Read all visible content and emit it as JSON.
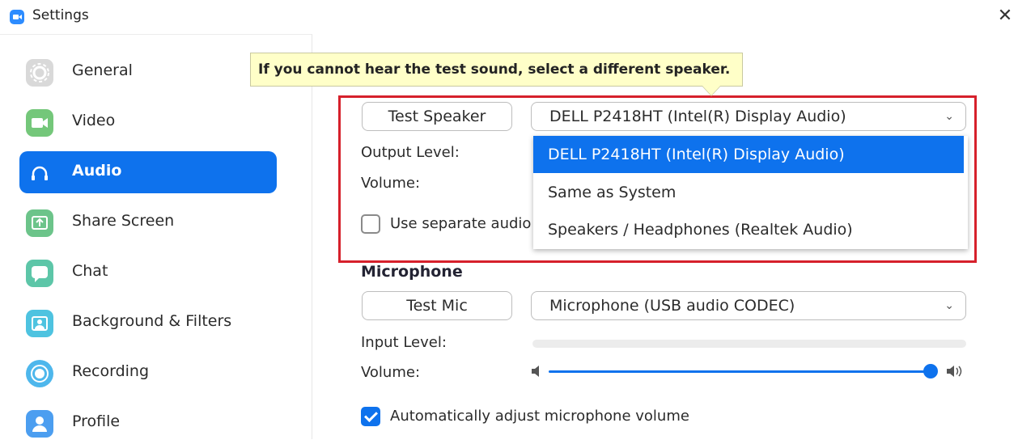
{
  "window": {
    "title": "Settings",
    "close_glyph": "✕"
  },
  "sidebar": {
    "items": [
      {
        "label": "General",
        "icon": "gear-icon",
        "color": "#D9D9D9"
      },
      {
        "label": "Video",
        "icon": "video-icon",
        "color": "#74C77A"
      },
      {
        "label": "Audio",
        "icon": "headphones-icon",
        "color": "#0E72ED",
        "active": true
      },
      {
        "label": "Share Screen",
        "icon": "share-screen-icon",
        "color": "#6CC48A"
      },
      {
        "label": "Chat",
        "icon": "chat-icon",
        "color": "#5DC6A8"
      },
      {
        "label": "Background & Filters",
        "icon": "background-icon",
        "color": "#4EC3E0"
      },
      {
        "label": "Recording",
        "icon": "recording-icon",
        "color": "#4EB7EC"
      },
      {
        "label": "Profile",
        "icon": "profile-icon",
        "color": "#4C9EF0"
      }
    ]
  },
  "tooltip": {
    "text": "If you cannot hear the test sound, select a different speaker."
  },
  "speaker": {
    "test_button": "Test Speaker",
    "selected": "DELL P2418HT (Intel(R) Display Audio)",
    "output_level_label": "Output Level:",
    "volume_label": "Volume:",
    "separate_audio_label": "Use separate audio",
    "separate_audio_checked": false,
    "options": [
      "DELL P2418HT (Intel(R) Display Audio)",
      "Same as System",
      "Speakers / Headphones (Realtek Audio)"
    ]
  },
  "microphone": {
    "section_title": "Microphone",
    "test_button": "Test Mic",
    "selected": "Microphone (USB audio CODEC)",
    "input_level_label": "Input Level:",
    "volume_label": "Volume:",
    "volume_level": 1.0,
    "auto_adjust_label": "Automatically adjust microphone volume",
    "auto_adjust_checked": true
  },
  "colors": {
    "accent": "#0E72ED",
    "highlight_border": "#D6202B",
    "tooltip_bg": "#FFFFC8"
  }
}
